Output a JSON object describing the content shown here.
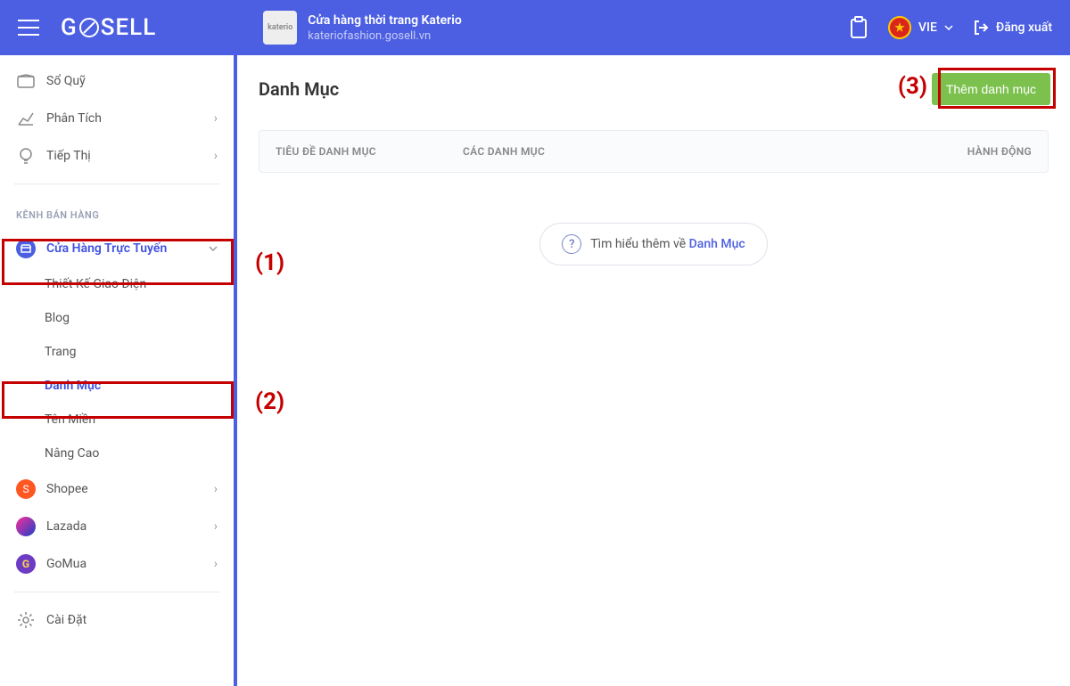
{
  "header": {
    "logo_text": "GOSELL",
    "store_name": "Cửa hàng thời trang Katerio",
    "store_url": "kateriofashion.gosell.vn",
    "lang": "VIE",
    "logout": "Đăng xuất"
  },
  "sidebar": {
    "items": [
      {
        "label": "Sổ Quỹ"
      },
      {
        "label": "Phân Tích"
      },
      {
        "label": "Tiếp Thị"
      }
    ],
    "section_title": "KÊNH BÁN HÀNG",
    "online_store": {
      "label": "Cửa Hàng Trực Tuyến",
      "subs": [
        "Thiết Kế Giao Diện",
        "Blog",
        "Trang",
        "Danh Mục",
        "Tên Miền",
        "Nâng Cao"
      ]
    },
    "channels": [
      {
        "label": "Shopee"
      },
      {
        "label": "Lazada"
      },
      {
        "label": "GoMua"
      }
    ],
    "settings": "Cài Đặt"
  },
  "main": {
    "title": "Danh Mục",
    "add_button": "Thêm danh mục",
    "columns": {
      "title": "TIÊU ĐỀ DANH MỤC",
      "cats": "CÁC DANH MỤC",
      "action": "HÀNH ĐỘNG"
    },
    "learn_more_prefix": "Tìm hiểu thêm về ",
    "learn_more_link": "Danh Mục"
  },
  "annotations": {
    "a1": "(1)",
    "a2": "(2)",
    "a3": "(3)"
  }
}
